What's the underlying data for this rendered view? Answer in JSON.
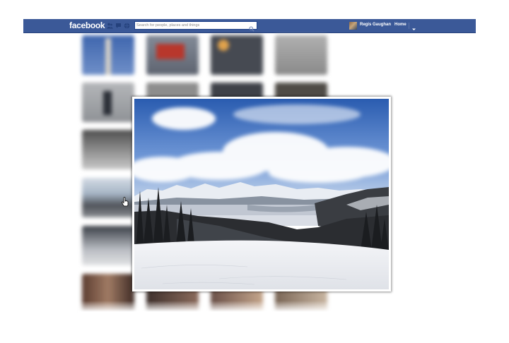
{
  "header": {
    "logo": "facebook",
    "search_placeholder": "Search for people, places and things",
    "user_name": "Regis Gaughan",
    "home_label": "Home"
  },
  "icons": {
    "search": "magnifier-icon",
    "friend_requests": "friends-icon",
    "messages": "messages-icon",
    "notifications": "globe-icon",
    "account_menu": "caret-down-icon",
    "cursor": "hand-pointer-icon"
  },
  "colors": {
    "brand_bar": "#3b5998",
    "bar_border": "#29447e",
    "page_background": "#ffffff"
  },
  "photo_grid": {
    "thumbnails": [
      {
        "row": 1,
        "col": 1,
        "scene": "sky with monument",
        "tone": "#4b6fae"
      },
      {
        "row": 1,
        "col": 2,
        "scene": "red flag",
        "tone": "#7a6e6a"
      },
      {
        "row": 1,
        "col": 3,
        "scene": "star ornament",
        "tone": "#4e4a46"
      },
      {
        "row": 1,
        "col": 4,
        "scene": "grey wall",
        "tone": "#9a9a9a"
      },
      {
        "row": 2,
        "col": 1,
        "scene": "person on beach",
        "tone": "#9ea1a4"
      },
      {
        "row": 2,
        "col": 2,
        "scene": "grey",
        "tone": "#8d8d8d"
      },
      {
        "row": 2,
        "col": 3,
        "scene": "dark scene",
        "tone": "#3e4148"
      },
      {
        "row": 2,
        "col": 4,
        "scene": "dark scene",
        "tone": "#4a4844"
      },
      {
        "row": 3,
        "col": 1,
        "scene": "people in snow",
        "tone": "#6a6a6a"
      },
      {
        "row": 4,
        "col": 1,
        "scene": "mountain sky",
        "tone": "#8ea3bb"
      },
      {
        "row": 5,
        "col": 1,
        "scene": "skiers",
        "tone": "#9a9da3"
      },
      {
        "row": 6,
        "col": 1,
        "scene": "group photo",
        "tone": "#6f4c3e"
      },
      {
        "row": 6,
        "col": 2,
        "scene": "group photo",
        "tone": "#5b4a42"
      },
      {
        "row": 6,
        "col": 3,
        "scene": "group photo",
        "tone": "#6a5048"
      },
      {
        "row": 6,
        "col": 4,
        "scene": "group photo",
        "tone": "#6e5a4e"
      }
    ]
  },
  "lightbox": {
    "photo_subject": "snowy mountain range under blue sky with clouds"
  }
}
